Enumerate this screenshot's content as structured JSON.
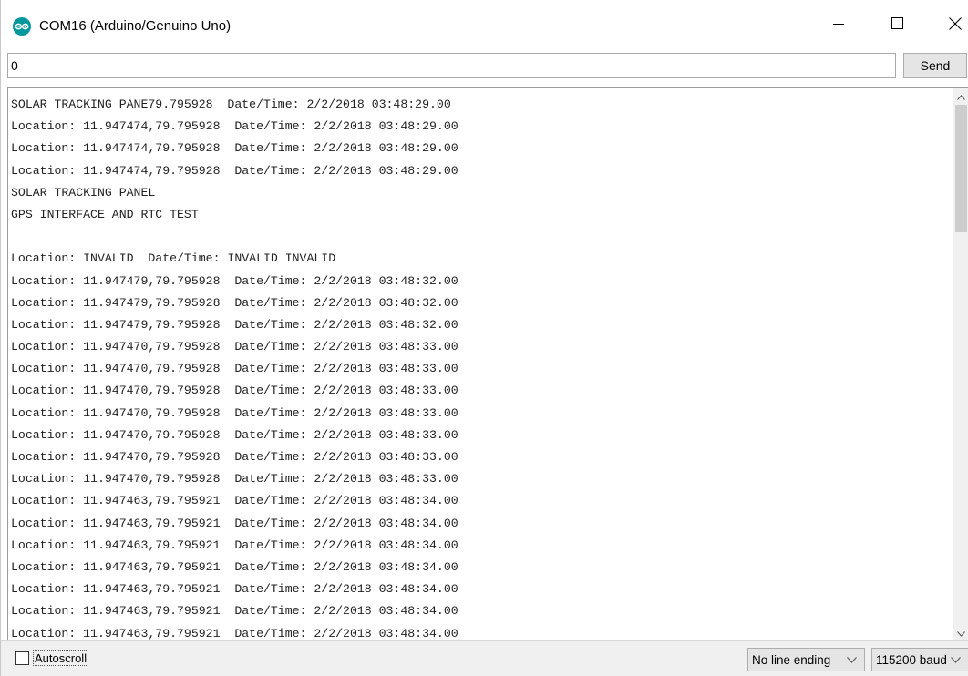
{
  "window": {
    "title": "COM16 (Arduino/Genuino Uno)",
    "icon": "arduino-logo-icon",
    "accent": "#00979c"
  },
  "input": {
    "value": "0",
    "send_label": "Send"
  },
  "output": {
    "lines": [
      "SOLAR TRACKING PANE79.795928  Date/Time: 2/2/2018 03:48:29.00",
      "Location: 11.947474,79.795928  Date/Time: 2/2/2018 03:48:29.00",
      "Location: 11.947474,79.795928  Date/Time: 2/2/2018 03:48:29.00",
      "Location: 11.947474,79.795928  Date/Time: 2/2/2018 03:48:29.00",
      "SOLAR TRACKING PANEL",
      "GPS INTERFACE AND RTC TEST",
      "",
      "Location: INVALID  Date/Time: INVALID INVALID",
      "Location: 11.947479,79.795928  Date/Time: 2/2/2018 03:48:32.00",
      "Location: 11.947479,79.795928  Date/Time: 2/2/2018 03:48:32.00",
      "Location: 11.947479,79.795928  Date/Time: 2/2/2018 03:48:32.00",
      "Location: 11.947470,79.795928  Date/Time: 2/2/2018 03:48:33.00",
      "Location: 11.947470,79.795928  Date/Time: 2/2/2018 03:48:33.00",
      "Location: 11.947470,79.795928  Date/Time: 2/2/2018 03:48:33.00",
      "Location: 11.947470,79.795928  Date/Time: 2/2/2018 03:48:33.00",
      "Location: 11.947470,79.795928  Date/Time: 2/2/2018 03:48:33.00",
      "Location: 11.947470,79.795928  Date/Time: 2/2/2018 03:48:33.00",
      "Location: 11.947470,79.795928  Date/Time: 2/2/2018 03:48:33.00",
      "Location: 11.947463,79.795921  Date/Time: 2/2/2018 03:48:34.00",
      "Location: 11.947463,79.795921  Date/Time: 2/2/2018 03:48:34.00",
      "Location: 11.947463,79.795921  Date/Time: 2/2/2018 03:48:34.00",
      "Location: 11.947463,79.795921  Date/Time: 2/2/2018 03:48:34.00",
      "Location: 11.947463,79.795921  Date/Time: 2/2/2018 03:48:34.00",
      "Location: 11.947463,79.795921  Date/Time: 2/2/2018 03:48:34.00",
      "Location: 11.947463,79.795921  Date/Time: 2/2/2018 03:48:34.00"
    ]
  },
  "footer": {
    "autoscroll_label": "Autoscroll",
    "autoscroll_checked": false,
    "line_ending": "No line ending",
    "baud_rate": "115200 baud"
  }
}
